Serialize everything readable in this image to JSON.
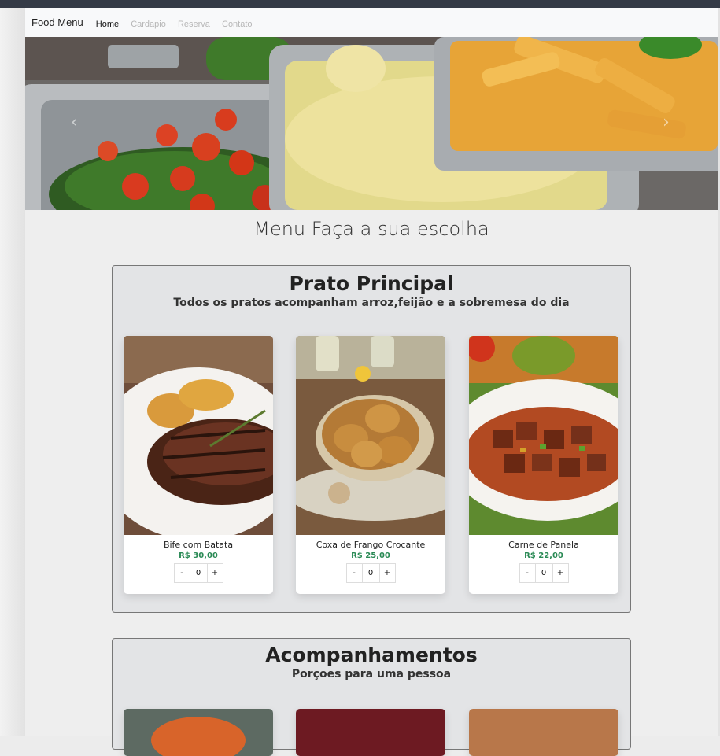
{
  "navbar": {
    "brand": "Food Menu",
    "links": [
      "Home",
      "Cardapio",
      "Reserva",
      "Contato"
    ],
    "active": "Home"
  },
  "carousel": {
    "prev_icon": "chevron-left-icon",
    "next_icon": "chevron-right-icon"
  },
  "heading": "Menu Faça a sua escolha",
  "sections": [
    {
      "title": "Prato Principal",
      "subtitle": "Todos os pratos acompanham arroz,feijão e a sobremesa do dia",
      "items": [
        {
          "name": "Bife com Batata",
          "price": "R$ 30,00",
          "qty": "0"
        },
        {
          "name": "Coxa de Frango Crocante",
          "price": "R$ 25,00",
          "qty": "0"
        },
        {
          "name": "Carne de Panela",
          "price": "R$ 22,00",
          "qty": "0"
        }
      ]
    },
    {
      "title": "Acompanhamentos",
      "subtitle": "Porçoes para uma pessoa"
    }
  ],
  "qty_controls": {
    "minus": "-",
    "plus": "+"
  },
  "colors": {
    "price": "#2a8a55",
    "topbar": "#343a46"
  }
}
